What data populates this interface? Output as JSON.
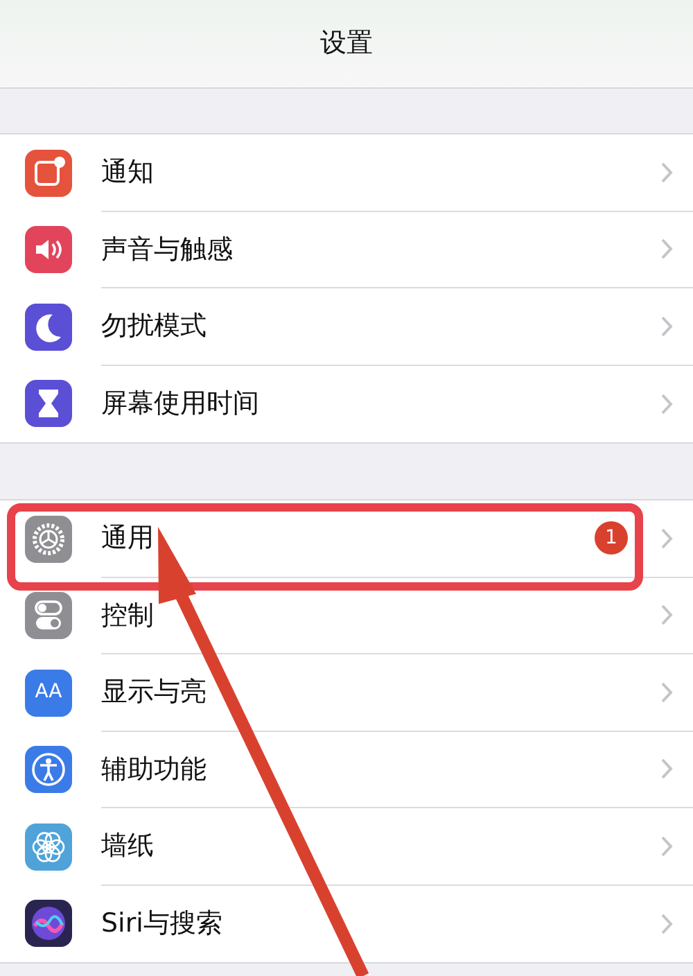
{
  "title": "设置",
  "groups": [
    {
      "items": [
        {
          "label": "通知",
          "kind": "notice",
          "color": "#e5533d",
          "highlighted": false
        },
        {
          "label": "声音与触感",
          "kind": "sound",
          "color": "#e2445c",
          "highlighted": false
        },
        {
          "label": "勿扰模式",
          "kind": "moon",
          "color": "#5b4fd6",
          "highlighted": false
        },
        {
          "label": "屏幕使用时间",
          "kind": "hourglass",
          "color": "#5b4fd6",
          "highlighted": false
        }
      ]
    },
    {
      "items": [
        {
          "label": "通用",
          "kind": "gear",
          "color": "#8e8e93",
          "highlighted": true,
          "badge": "1"
        },
        {
          "label": "控制",
          "kind": "toggles",
          "color": "#8e8e93",
          "highlighted": false
        },
        {
          "label": "显示与亮",
          "kind": "text",
          "icon_text": "AA",
          "color": "#3b7be8",
          "highlighted": false
        },
        {
          "label": "辅助功能",
          "kind": "person",
          "color": "#3b7be8",
          "highlighted": false
        },
        {
          "label": "墙纸",
          "kind": "flower",
          "color": "#4fa3d9",
          "highlighted": false
        },
        {
          "label": "Siri与搜索",
          "kind": "orb",
          "color": "#2a2550",
          "highlighted": false
        }
      ]
    }
  ]
}
